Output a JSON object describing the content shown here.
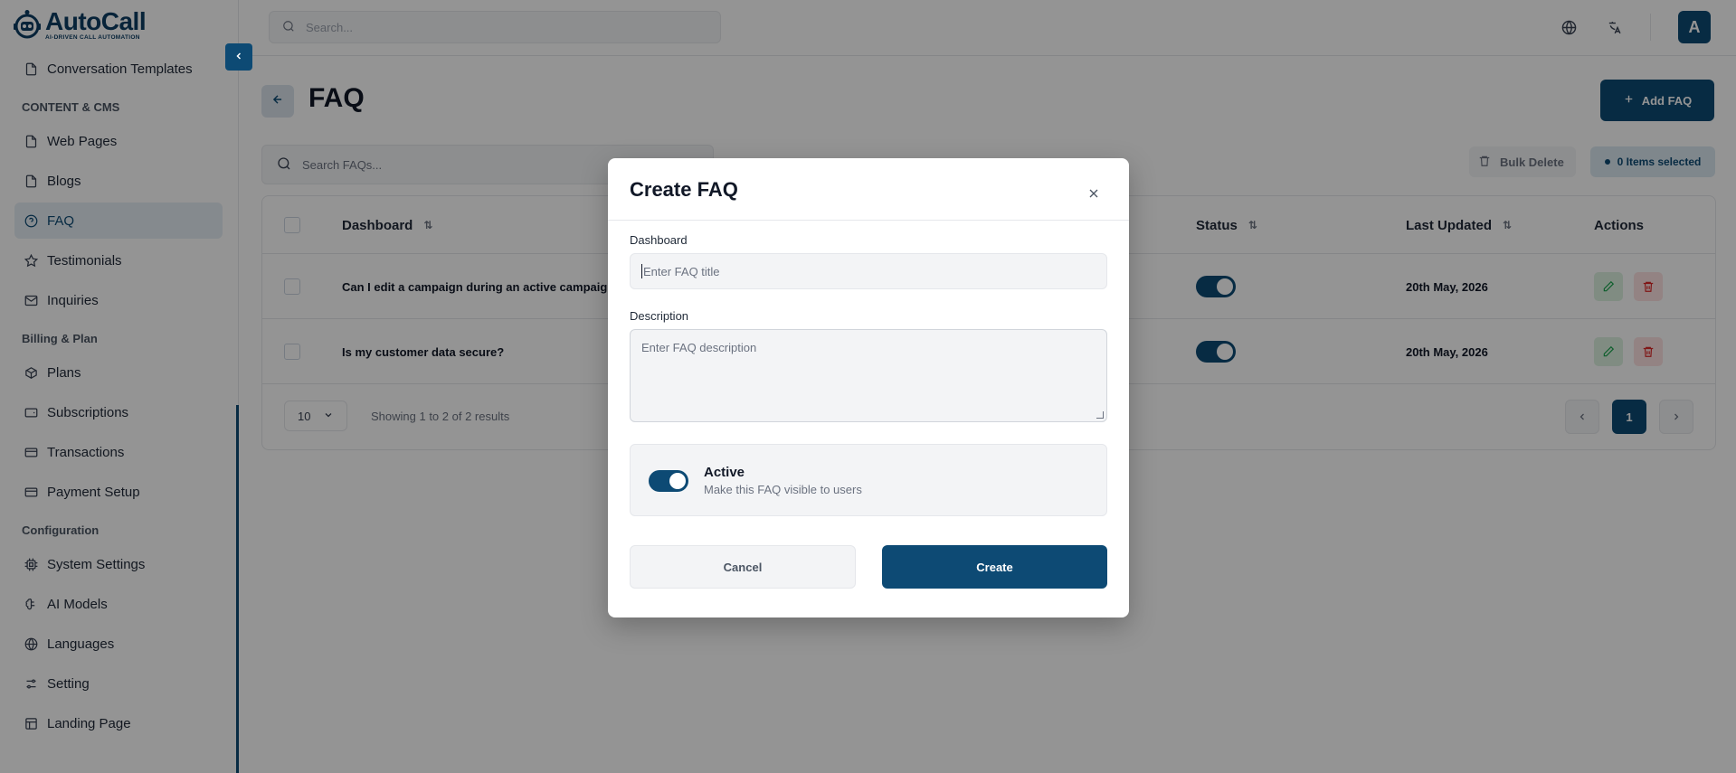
{
  "brand": {
    "name_part1": "Auto",
    "name_part2": "Call",
    "tagline": "AI-DRIVEN CALL AUTOMATION"
  },
  "colors": {
    "primary": "#0d4a74",
    "edit": "#16a34a",
    "delete": "#dc2626"
  },
  "sidebar": {
    "items": [
      {
        "label": "Conversation Templates",
        "icon": "file-icon"
      },
      {
        "section": "CONTENT & CMS"
      },
      {
        "label": "Web Pages",
        "icon": "file-icon"
      },
      {
        "label": "Blogs",
        "icon": "file-icon"
      },
      {
        "label": "FAQ",
        "icon": "help-circle-icon",
        "active": true
      },
      {
        "label": "Testimonials",
        "icon": "star-icon"
      },
      {
        "label": "Inquiries",
        "icon": "mail-icon"
      },
      {
        "section": "Billing & Plan"
      },
      {
        "label": "Plans",
        "icon": "package-icon"
      },
      {
        "label": "Subscriptions",
        "icon": "wallet-icon"
      },
      {
        "label": "Transactions",
        "icon": "credit-card-icon"
      },
      {
        "label": "Payment Setup",
        "icon": "wallet-icon"
      },
      {
        "section": "Configuration"
      },
      {
        "label": "System Settings",
        "icon": "cpu-icon"
      },
      {
        "label": "AI Models",
        "icon": "brain-icon"
      },
      {
        "label": "Languages",
        "icon": "globe-icon"
      },
      {
        "label": "Setting",
        "icon": "sliders-icon"
      },
      {
        "label": "Landing Page",
        "icon": "layout-icon"
      }
    ]
  },
  "topbar": {
    "search_placeholder": "Search...",
    "avatar_initial": "A"
  },
  "page": {
    "title": "FAQ",
    "add_label": "Add FAQ",
    "search_placeholder": "Search FAQs...",
    "bulk_delete_label": "Bulk Delete",
    "items_selected_label": "0 Items selected"
  },
  "table": {
    "columns": [
      "Dashboard",
      "Status",
      "Last Updated",
      "Actions"
    ],
    "rows": [
      {
        "question": "Can I edit a campaign during an active campaign?",
        "active": true,
        "updated": "20th May, 2026"
      },
      {
        "question": "Is my customer data secure?",
        "active": true,
        "updated": "20th May, 2026"
      }
    ],
    "per_page": "10",
    "showing": "Showing 1 to 2 of 2 results",
    "current_page": "1"
  },
  "modal": {
    "title": "Create FAQ",
    "title_label": "Dashboard",
    "title_placeholder": "Enter FAQ title",
    "description_label": "Description",
    "description_placeholder": "Enter FAQ description",
    "active_title": "Active",
    "active_desc": "Make this FAQ visible to users",
    "active": true,
    "cancel_label": "Cancel",
    "create_label": "Create"
  }
}
